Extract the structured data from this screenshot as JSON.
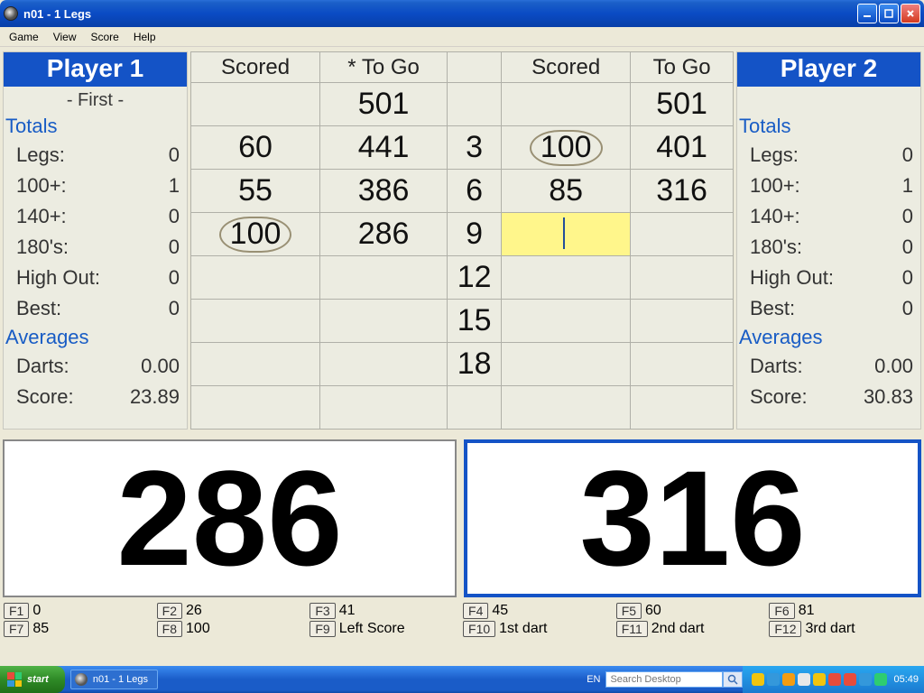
{
  "window": {
    "title": "n01 - 1 Legs"
  },
  "menu": {
    "game": "Game",
    "view": "View",
    "score": "Score",
    "help": "Help"
  },
  "players": {
    "p1": {
      "name": "Player 1",
      "first_label": "- First -",
      "totals_label": "Totals",
      "legs_k": "Legs:",
      "legs_v": "0",
      "hundred_k": "100+:",
      "hundred_v": "1",
      "oneforty_k": "140+:",
      "oneforty_v": "0",
      "oneeighty_k": "180's:",
      "oneeighty_v": "0",
      "highout_k": "High Out:",
      "highout_v": "0",
      "best_k": "Best:",
      "best_v": "0",
      "averages_label": "Averages",
      "darts_k": "Darts:",
      "darts_v": "0.00",
      "score_k": "Score:",
      "score_v": "23.89"
    },
    "p2": {
      "name": "Player 2",
      "totals_label": "Totals",
      "legs_k": "Legs:",
      "legs_v": "0",
      "hundred_k": "100+:",
      "hundred_v": "1",
      "oneforty_k": "140+:",
      "oneforty_v": "0",
      "oneeighty_k": "180's:",
      "oneeighty_v": "0",
      "highout_k": "High Out:",
      "highout_v": "0",
      "best_k": "Best:",
      "best_v": "0",
      "averages_label": "Averages",
      "darts_k": "Darts:",
      "darts_v": "0.00",
      "score_k": "Score:",
      "score_v": "30.83"
    }
  },
  "table": {
    "headers": {
      "scored1": "Scored",
      "togo1": "* To Go",
      "scored2": "Scored",
      "togo2": "To Go"
    },
    "rows": [
      {
        "s1": "",
        "t1": "501",
        "d": "",
        "s2": "",
        "t2": "501",
        "s2_circled": false,
        "s1_circled": false,
        "s2_input": false
      },
      {
        "s1": "60",
        "t1": "441",
        "d": "3",
        "s2": "100",
        "t2": "401",
        "s2_circled": true,
        "s1_circled": false,
        "s2_input": false
      },
      {
        "s1": "55",
        "t1": "386",
        "d": "6",
        "s2": "85",
        "t2": "316",
        "s2_circled": false,
        "s1_circled": false,
        "s2_input": false
      },
      {
        "s1": "100",
        "t1": "286",
        "d": "9",
        "s2": "",
        "t2": "",
        "s2_circled": false,
        "s1_circled": true,
        "s2_input": true
      },
      {
        "s1": "",
        "t1": "",
        "d": "12",
        "s2": "",
        "t2": "",
        "s2_circled": false,
        "s1_circled": false,
        "s2_input": false
      },
      {
        "s1": "",
        "t1": "",
        "d": "15",
        "s2": "",
        "t2": "",
        "s2_circled": false,
        "s1_circled": false,
        "s2_input": false
      },
      {
        "s1": "",
        "t1": "",
        "d": "18",
        "s2": "",
        "t2": "",
        "s2_circled": false,
        "s1_circled": false,
        "s2_input": false
      },
      {
        "s1": "",
        "t1": "",
        "d": "",
        "s2": "",
        "t2": "",
        "s2_circled": false,
        "s1_circled": false,
        "s2_input": false
      }
    ]
  },
  "big": {
    "left": "286",
    "right": "316"
  },
  "fkeys": {
    "f1": {
      "key": "F1",
      "label": "0"
    },
    "f2": {
      "key": "F2",
      "label": "26"
    },
    "f3": {
      "key": "F3",
      "label": "41"
    },
    "f4": {
      "key": "F4",
      "label": "45"
    },
    "f5": {
      "key": "F5",
      "label": "60"
    },
    "f6": {
      "key": "F6",
      "label": "81"
    },
    "f7": {
      "key": "F7",
      "label": "85"
    },
    "f8": {
      "key": "F8",
      "label": "100"
    },
    "f9": {
      "key": "F9",
      "label": "Left Score"
    },
    "f10": {
      "key": "F10",
      "label": "1st dart"
    },
    "f11": {
      "key": "F11",
      "label": "2nd dart"
    },
    "f12": {
      "key": "F12",
      "label": "3rd dart"
    }
  },
  "taskbar": {
    "start": "start",
    "app_task": "n01 - 1 Legs",
    "lang": "EN",
    "search_placeholder": "Search Desktop",
    "clock": "05:49"
  },
  "colors": {
    "accent_blue": "#1453c6",
    "panel_bg": "#ecece1",
    "input_bg": "#fff68b"
  }
}
